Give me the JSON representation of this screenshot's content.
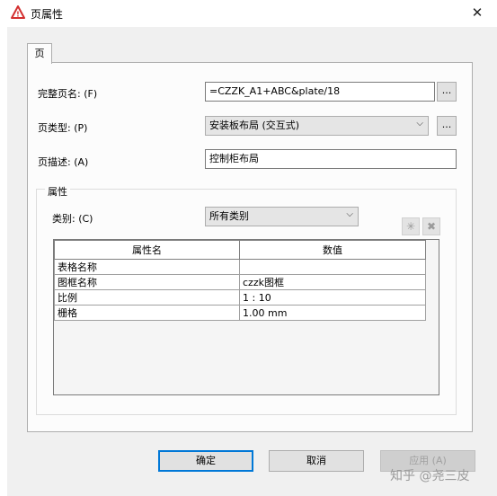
{
  "window": {
    "title": "页属性",
    "close_symbol": "✕"
  },
  "tabs": [
    {
      "label": "页"
    }
  ],
  "fields": {
    "full_name": {
      "label": "完整页名: (F)",
      "value": "=CZZK_A1+ABC&plate/18",
      "button": "..."
    },
    "page_type": {
      "label": "页类型: (P)",
      "value": "安装板布局 (交互式)",
      "button": "..."
    },
    "description": {
      "label": "页描述: (A)",
      "value": "控制柜布局"
    }
  },
  "properties": {
    "group_title": "属性",
    "category_label": "类别: (C)",
    "category_value": "所有类别",
    "add_symbol": "✳",
    "delete_symbol": "✖",
    "columns": [
      "属性名",
      "数值"
    ],
    "rows": [
      {
        "name": "表格名称",
        "value": ""
      },
      {
        "name": "图框名称",
        "value": "czzk图框"
      },
      {
        "name": "比例",
        "value": "1 : 10"
      },
      {
        "name": "栅格",
        "value": "1.00 mm"
      }
    ]
  },
  "buttons": {
    "ok": "确定",
    "cancel": "取消",
    "apply": "应用 (A)"
  },
  "watermark": "知乎 @尧三皮",
  "colors": {
    "accent": "#0078d7",
    "warning_icon": "#d32f2f"
  }
}
